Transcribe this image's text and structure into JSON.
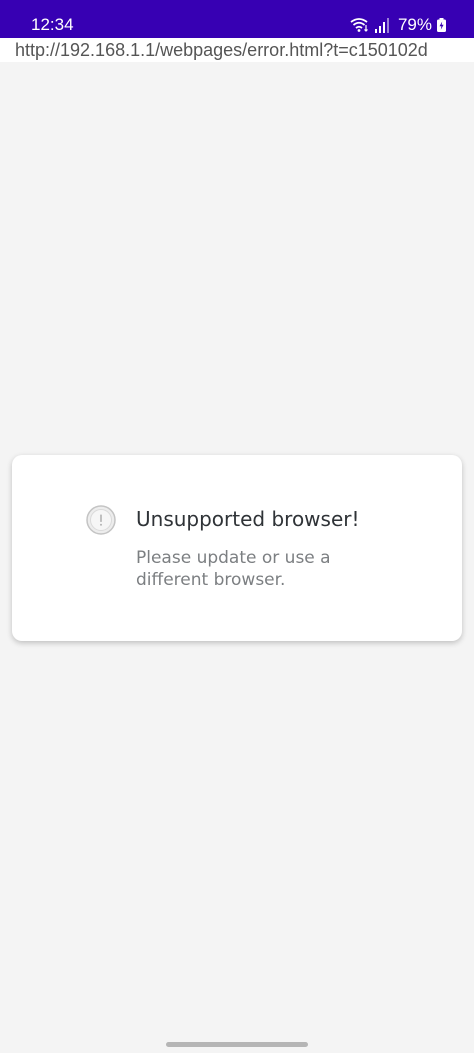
{
  "status_bar": {
    "time": "12:34",
    "battery": "79%",
    "icons": [
      "wifi-calling-icon",
      "signal-icon",
      "battery-charging-icon"
    ]
  },
  "browser": {
    "url": "http://192.168.1.1/webpages/error.html?t=c150102d"
  },
  "error_card": {
    "icon": "warning-circle-icon",
    "title": "Unsupported browser!",
    "message": "Please update or use a different browser."
  },
  "colors": {
    "status_bar_bg": "#3700b3",
    "page_bg": "#f4f4f4",
    "card_bg": "#ffffff",
    "title_text": "#2f3337",
    "message_text": "#7c7f82"
  }
}
